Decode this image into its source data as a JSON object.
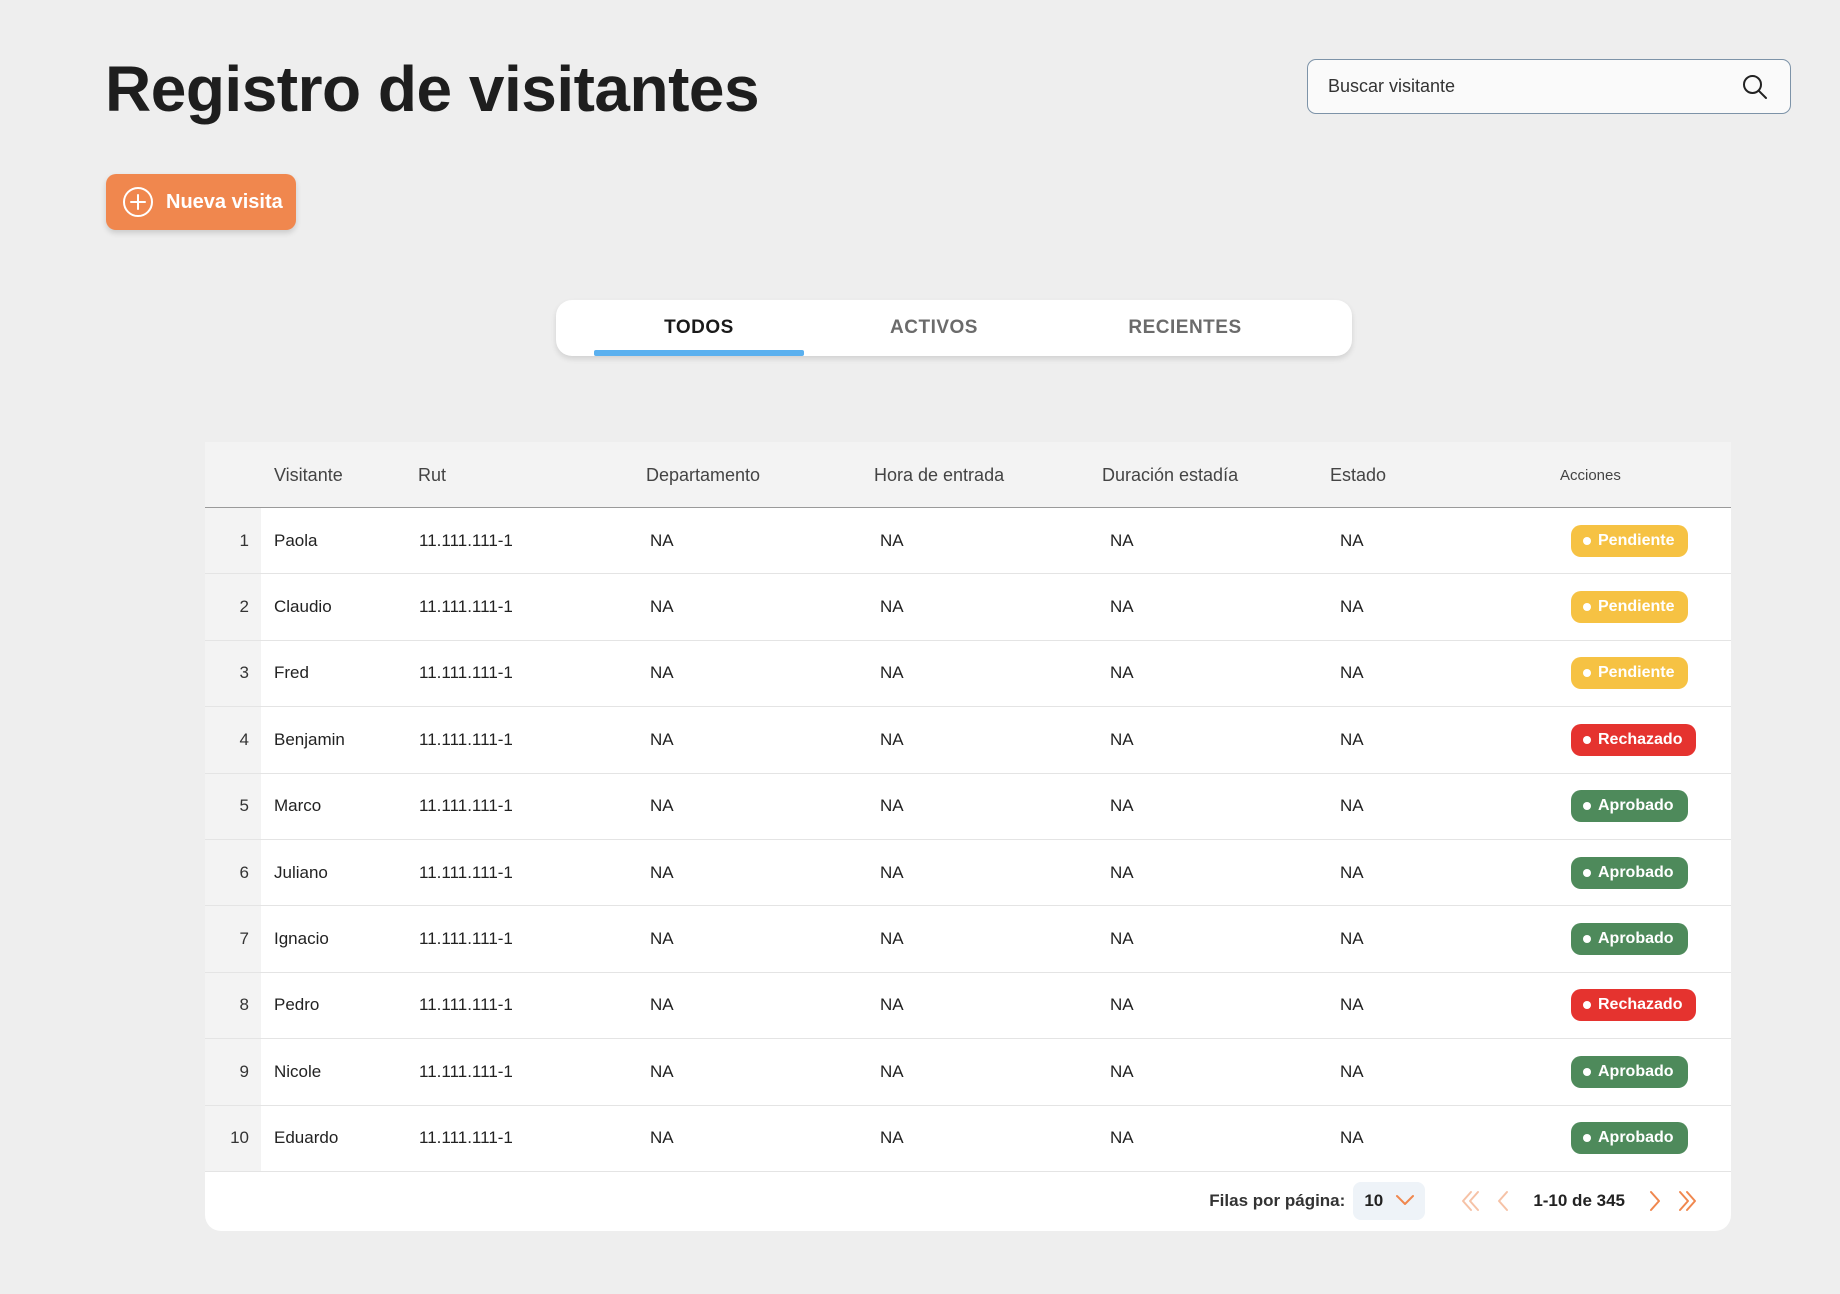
{
  "header": {
    "title": "Registro de visitantes"
  },
  "search": {
    "placeholder": "Buscar visitante",
    "icon": "search-icon"
  },
  "actions": {
    "new_visit_label": "Nueva visita",
    "new_visit_icon": "plus-circle-icon"
  },
  "tabs": [
    {
      "label": "TODOS",
      "active": true
    },
    {
      "label": "ACTIVOS",
      "active": false
    },
    {
      "label": "RECIENTES",
      "active": false
    }
  ],
  "table": {
    "columns": [
      "Visitante",
      "Rut",
      "Departamento",
      "Hora de entrada",
      "Duración estadía",
      "Estado",
      "Acciones"
    ],
    "rows": [
      {
        "num": "1",
        "visitante": "Paola",
        "rut": "11.111.111-1",
        "departamento": "NA",
        "hora": "NA",
        "duracion": "NA",
        "estado": "NA",
        "accion": "Pendiente"
      },
      {
        "num": "2",
        "visitante": "Claudio",
        "rut": "11.111.111-1",
        "departamento": "NA",
        "hora": "NA",
        "duracion": "NA",
        "estado": "NA",
        "accion": "Pendiente"
      },
      {
        "num": "3",
        "visitante": "Fred",
        "rut": "11.111.111-1",
        "departamento": "NA",
        "hora": "NA",
        "duracion": "NA",
        "estado": "NA",
        "accion": "Pendiente"
      },
      {
        "num": "4",
        "visitante": "Benjamin",
        "rut": "11.111.111-1",
        "departamento": "NA",
        "hora": "NA",
        "duracion": "NA",
        "estado": "NA",
        "accion": "Rechazado"
      },
      {
        "num": "5",
        "visitante": "Marco",
        "rut": "11.111.111-1",
        "departamento": "NA",
        "hora": "NA",
        "duracion": "NA",
        "estado": "NA",
        "accion": "Aprobado"
      },
      {
        "num": "6",
        "visitante": "Juliano",
        "rut": "11.111.111-1",
        "departamento": "NA",
        "hora": "NA",
        "duracion": "NA",
        "estado": "NA",
        "accion": "Aprobado"
      },
      {
        "num": "7",
        "visitante": "Ignacio",
        "rut": "11.111.111-1",
        "departamento": "NA",
        "hora": "NA",
        "duracion": "NA",
        "estado": "NA",
        "accion": "Aprobado"
      },
      {
        "num": "8",
        "visitante": "Pedro",
        "rut": "11.111.111-1",
        "departamento": "NA",
        "hora": "NA",
        "duracion": "NA",
        "estado": "NA",
        "accion": "Rechazado"
      },
      {
        "num": "9",
        "visitante": "Nicole",
        "rut": "11.111.111-1",
        "departamento": "NA",
        "hora": "NA",
        "duracion": "NA",
        "estado": "NA",
        "accion": "Aprobado"
      },
      {
        "num": "10",
        "visitante": "Eduardo",
        "rut": "11.111.111-1",
        "departamento": "NA",
        "hora": "NA",
        "duracion": "NA",
        "estado": "NA",
        "accion": "Aprobado"
      }
    ]
  },
  "status_colors": {
    "Pendiente": "#f6c243",
    "Rechazado": "#e5332f",
    "Aprobado": "#4e8a5b"
  },
  "pagination": {
    "rows_per_page_label": "Filas por página:",
    "rows_per_page": "10",
    "range": "1-10 de 345",
    "icons": [
      "double-chevron-left-icon",
      "chevron-left-icon",
      "chevron-right-icon",
      "double-chevron-right-icon"
    ]
  },
  "colors": {
    "accent": "#f0874e",
    "tab_indicator": "#5ab0ef",
    "background": "#eeeeee"
  }
}
